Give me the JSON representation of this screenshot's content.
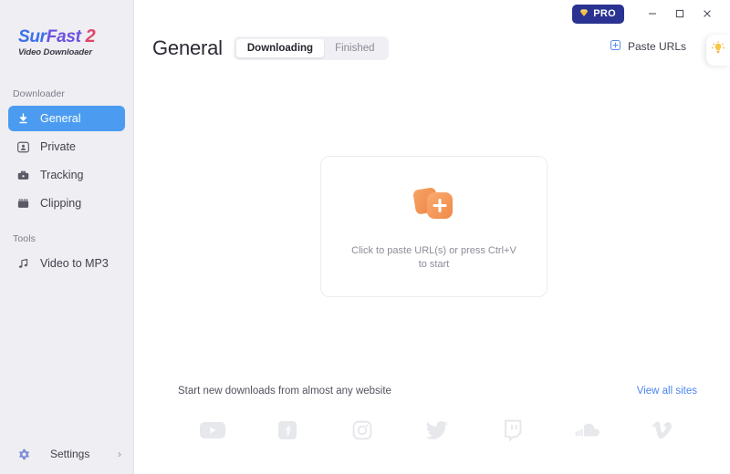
{
  "window": {
    "pro_label": "PRO",
    "pro_icon": "gem-icon",
    "minimize_label": "–",
    "maximize_label": "□",
    "close_label": "✕"
  },
  "sidebar": {
    "logo": {
      "part1": "Sur",
      "part2": "Fast",
      "version": "2",
      "subtitle": "Video Downloader"
    },
    "sections": [
      {
        "label": "Downloader",
        "items": [
          {
            "label": "General",
            "icon": "download-arrow-icon",
            "active": true
          },
          {
            "label": "Private",
            "icon": "private-person-icon",
            "active": false
          },
          {
            "label": "Tracking",
            "icon": "briefcase-icon",
            "active": false
          },
          {
            "label": "Clipping",
            "icon": "film-strip-icon",
            "active": false
          }
        ]
      },
      {
        "label": "Tools",
        "items": [
          {
            "label": "Video to MP3",
            "icon": "music-note-icon",
            "active": false
          }
        ]
      }
    ],
    "settings": {
      "label": "Settings",
      "icon": "gear-icon",
      "chevron": "›"
    }
  },
  "header": {
    "title": "General",
    "tabs": [
      {
        "label": "Downloading",
        "active": true
      },
      {
        "label": "Finished",
        "active": false
      }
    ],
    "paste_urls": {
      "label": "Paste URLs",
      "icon": "plus-square-icon"
    },
    "tips": {
      "icon": "lightbulb-icon"
    }
  },
  "dropzone": {
    "icon": "folder-plus-icon",
    "line1": "Click to paste URL(s) or press Ctrl+V",
    "line2": "to start"
  },
  "footer": {
    "text": "Start new downloads from almost any website",
    "link": "View all sites",
    "sites": [
      {
        "name": "youtube-icon"
      },
      {
        "name": "facebook-icon"
      },
      {
        "name": "instagram-icon"
      },
      {
        "name": "twitter-icon"
      },
      {
        "name": "twitch-icon"
      },
      {
        "name": "soundcloud-icon"
      },
      {
        "name": "vimeo-icon"
      }
    ]
  },
  "colors": {
    "accent_blue": "#4b9cf0",
    "link_blue": "#4b86f0",
    "pro_navy": "#2a3391",
    "sidebar_bg": "#efeef2",
    "orange": "#f08a4b"
  }
}
